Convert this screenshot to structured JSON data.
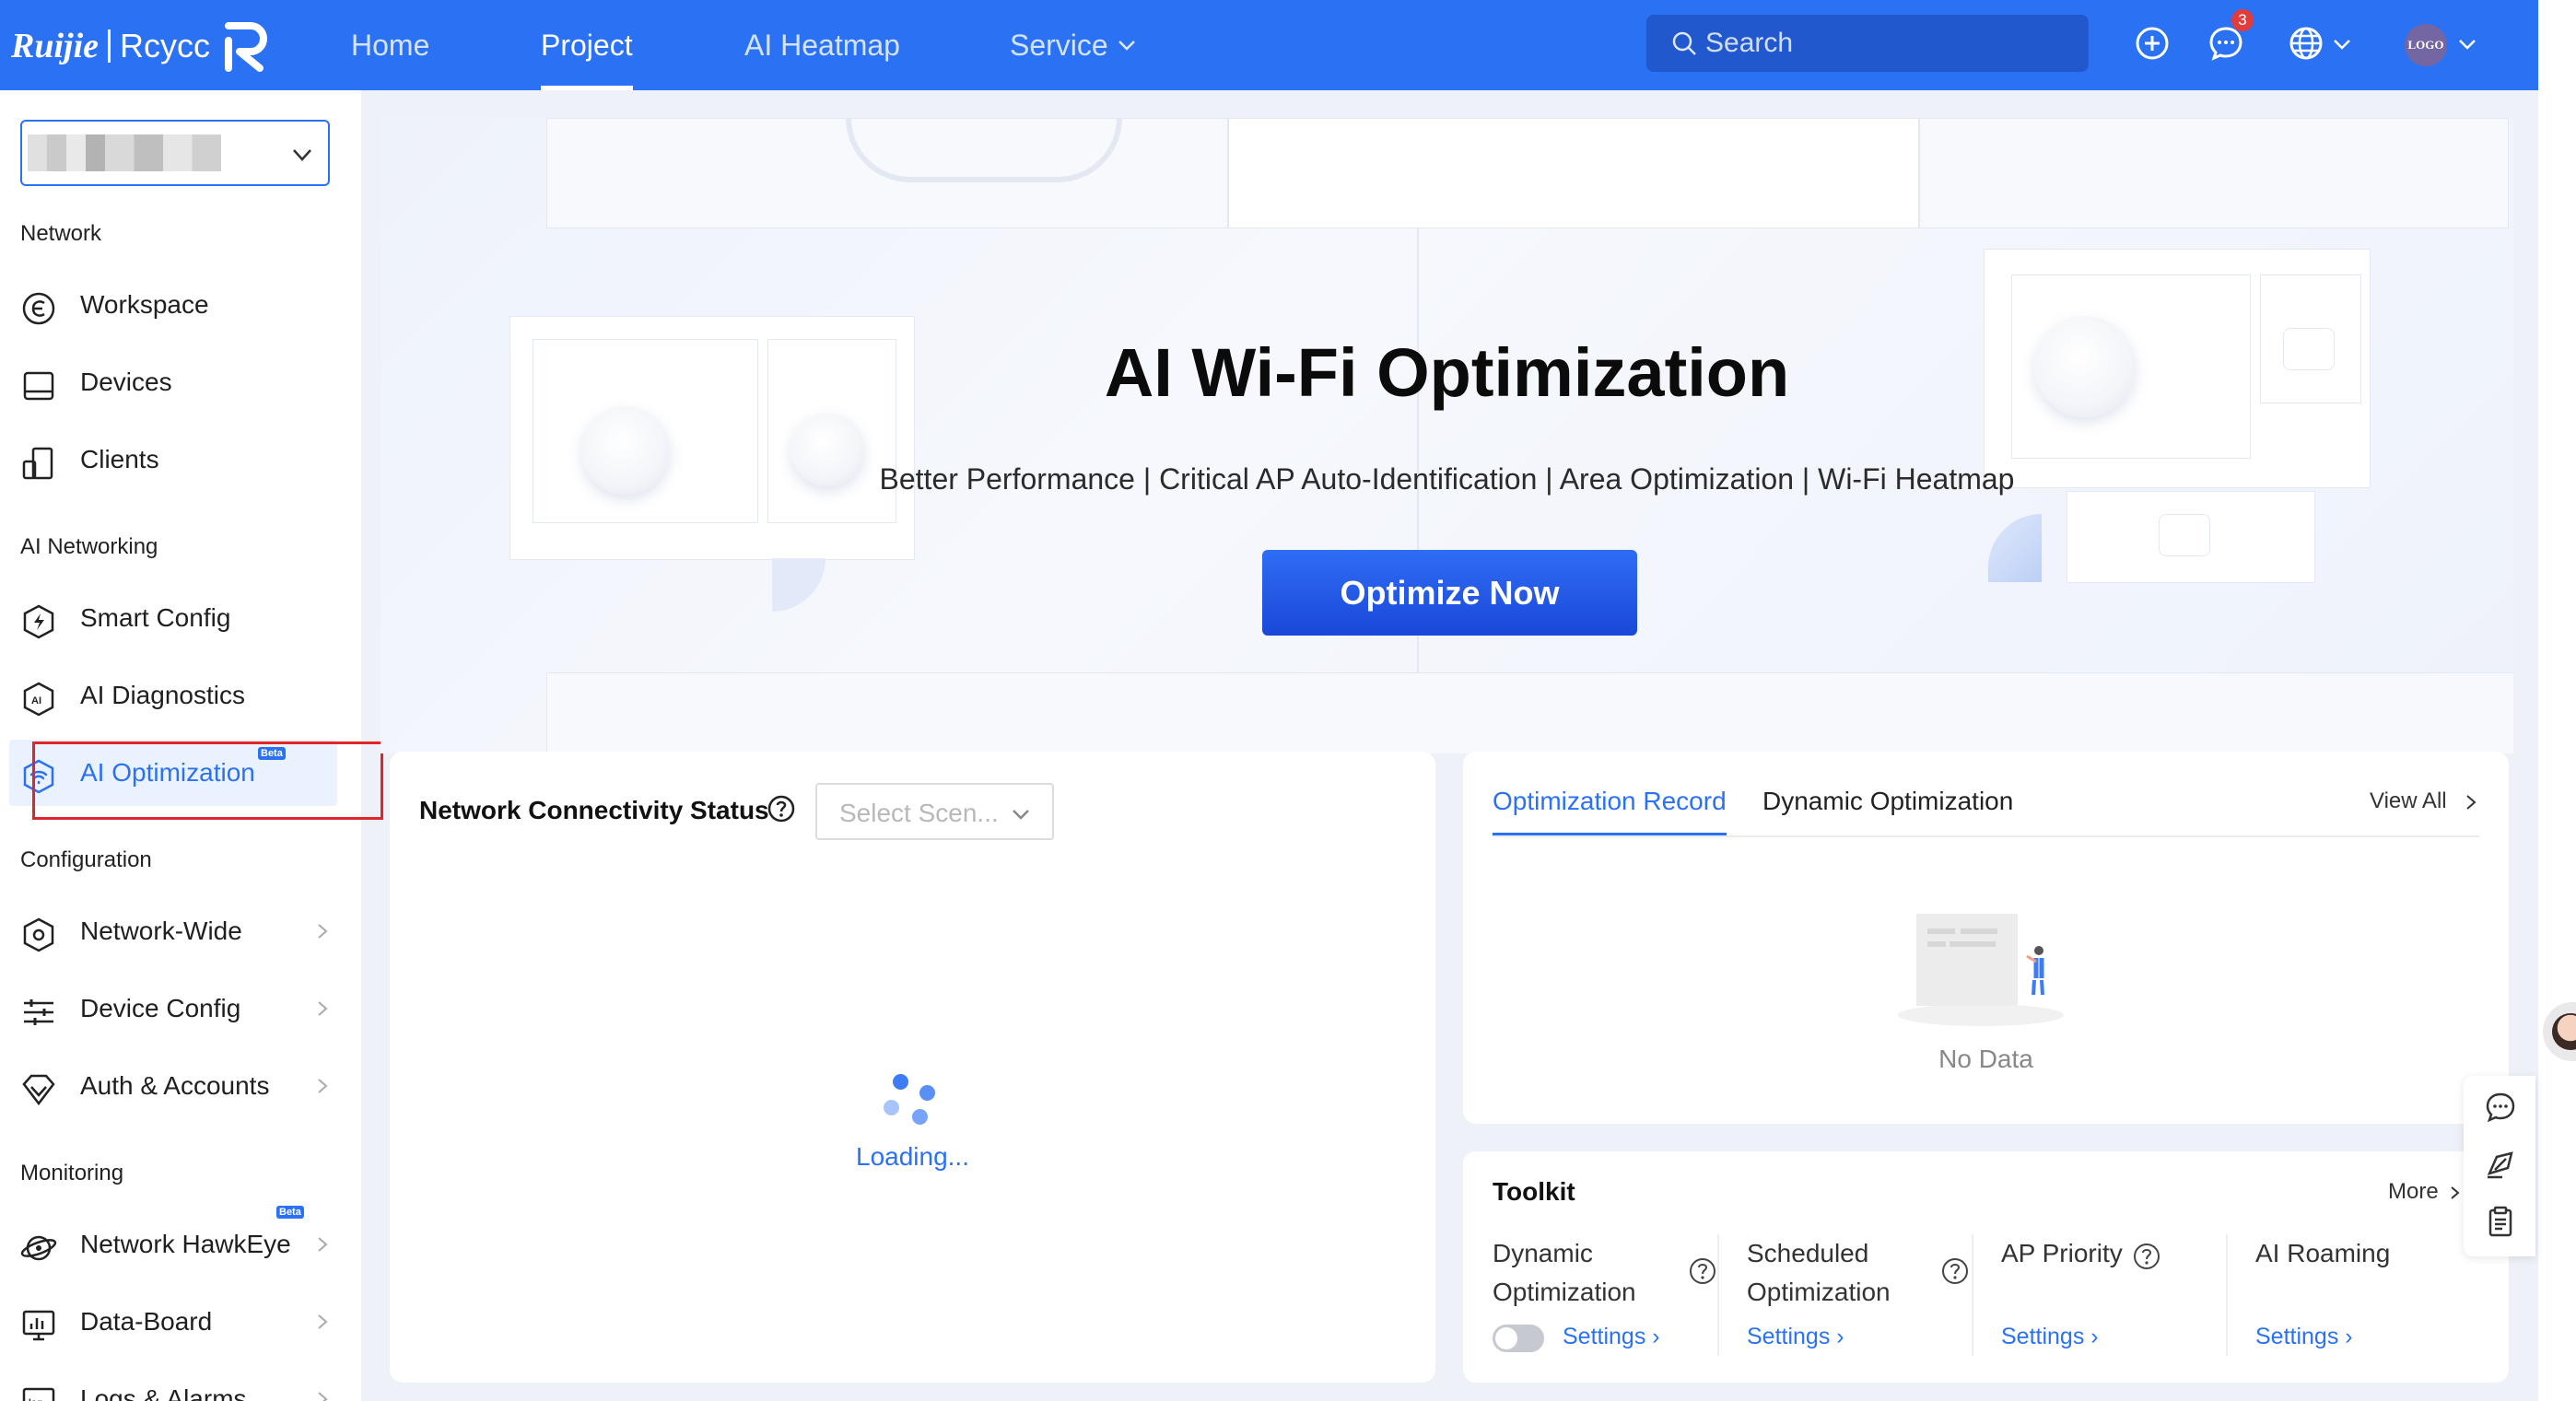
{
  "header": {
    "logo_brand": "Ruijie",
    "logo_sub": "Rcycc",
    "nav": [
      "Home",
      "Project",
      "AI Heatmap",
      "Service"
    ],
    "active_nav": "Project",
    "search_placeholder": "Search",
    "notification_count": "3",
    "avatar_text": "LOGO",
    "accent": "#2a72f3"
  },
  "sidebar": {
    "sections": {
      "network": "Network",
      "ai_networking": "AI Networking",
      "configuration": "Configuration",
      "monitoring": "Monitoring"
    },
    "items": [
      {
        "label": "Workspace",
        "icon": "workspace-icon"
      },
      {
        "label": "Devices",
        "icon": "devices-icon"
      },
      {
        "label": "Clients",
        "icon": "clients-icon"
      },
      {
        "label": "Smart Config",
        "icon": "smart-config-icon"
      },
      {
        "label": "AI Diagnostics",
        "icon": "ai-diagnostics-icon"
      },
      {
        "label": "AI Optimization",
        "icon": "ai-optimization-icon",
        "badge": "Beta",
        "active": true
      },
      {
        "label": "Network-Wide",
        "icon": "network-wide-icon"
      },
      {
        "label": "Device Config",
        "icon": "device-config-icon"
      },
      {
        "label": "Auth & Accounts",
        "icon": "auth-icon"
      },
      {
        "label": "Network HawkEye",
        "icon": "hawkeye-icon",
        "badge": "Beta"
      },
      {
        "label": "Data-Board",
        "icon": "data-board-icon"
      },
      {
        "label": "Logs & Alarms",
        "icon": "logs-icon"
      }
    ]
  },
  "hero": {
    "title": "AI Wi-Fi Optimization",
    "features": "Better Performance | Critical AP Auto-Identification | Area Optimization | Wi-Fi Heatmap",
    "button": "Optimize Now"
  },
  "connectivity": {
    "title": "Network Connectivity Status",
    "select_placeholder": "Select Scen...",
    "loading": "Loading..."
  },
  "records": {
    "tabs": [
      "Optimization Record",
      "Dynamic Optimization"
    ],
    "view_all": "View All",
    "empty": "No Data"
  },
  "toolkit": {
    "title": "Toolkit",
    "more": "More",
    "tools": [
      {
        "name": "Dynamic Optimization",
        "link": "Settings"
      },
      {
        "name": "Scheduled Optimization",
        "link": "Settings"
      },
      {
        "name": "AP Priority",
        "link": "Settings"
      },
      {
        "name": "AI Roaming",
        "link": "Settings"
      }
    ]
  }
}
